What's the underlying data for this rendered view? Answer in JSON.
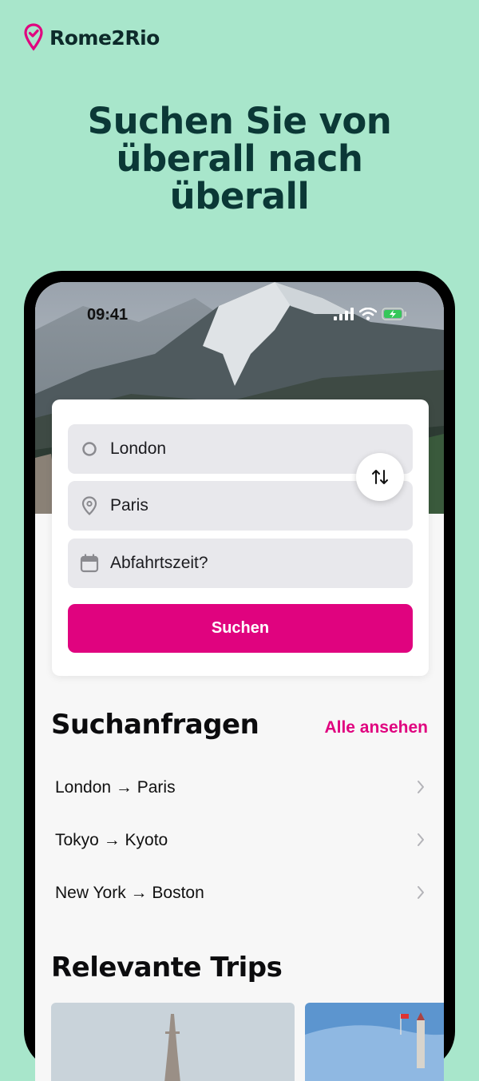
{
  "brand": {
    "name": "Rome2Rio",
    "logo_icon": "pin-check-icon",
    "color": "#e0037f"
  },
  "headline": {
    "line1": "Suchen Sie von",
    "line2": "überall nach",
    "line3": "überall"
  },
  "status_bar": {
    "time": "09:41",
    "icons": [
      "signal-icon",
      "wifi-icon",
      "battery-charging-icon"
    ]
  },
  "search": {
    "origin": {
      "value": "London",
      "icon": "circle-icon"
    },
    "destination": {
      "value": "Paris",
      "icon": "location-pin-icon"
    },
    "date": {
      "placeholder": "Abfahrtszeit?",
      "icon": "calendar-icon"
    },
    "swap_icon": "swap-arrows-icon",
    "button_label": "Suchen"
  },
  "recent": {
    "title": "Suchanfragen",
    "see_all": "Alle ansehen",
    "items": [
      {
        "label": "London → Paris"
      },
      {
        "label": "Tokyo → Kyoto"
      },
      {
        "label": "New York → Boston"
      }
    ]
  },
  "trips": {
    "title": "Relevante Trips"
  },
  "colors": {
    "background": "#a8e6cb",
    "accent": "#e0037f",
    "headline": "#0b3836"
  }
}
